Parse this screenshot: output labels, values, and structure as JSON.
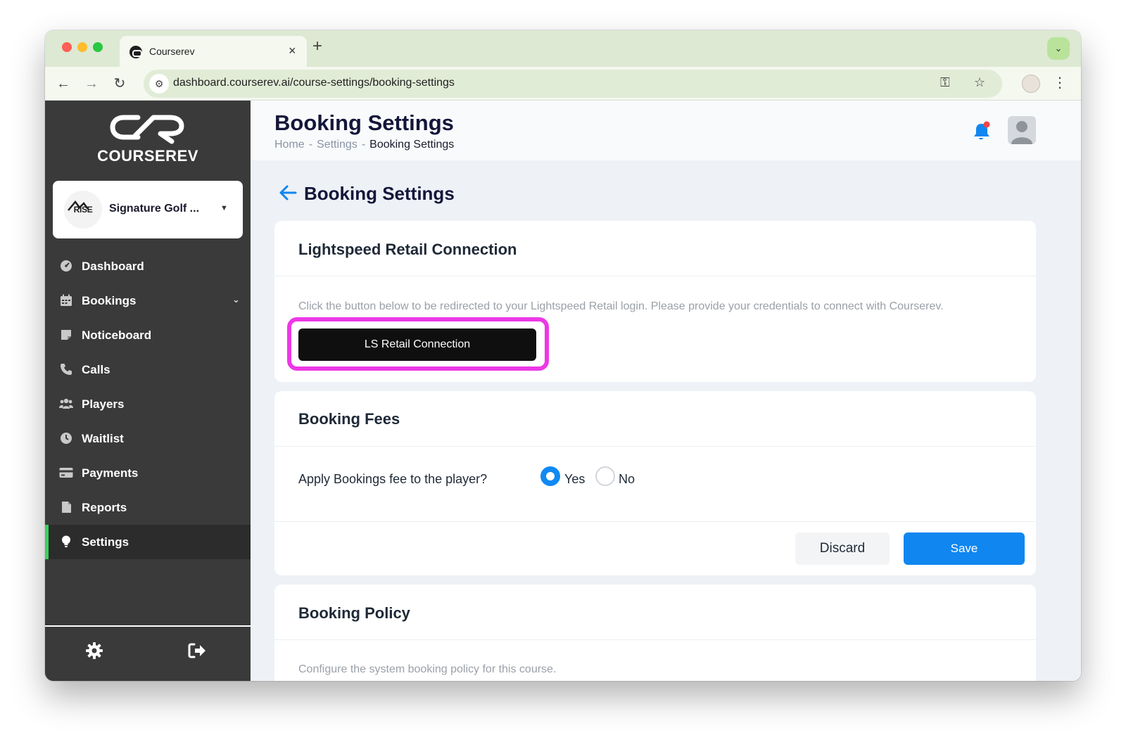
{
  "browser": {
    "tab_title": "Courserev",
    "tab_close": "×",
    "new_tab": "+",
    "url": "dashboard.courserev.ai/course-settings/booking-settings",
    "nav": {
      "back": "←",
      "forward": "→",
      "reload": "↻"
    }
  },
  "sidebar": {
    "brand": "COURSEREV",
    "org": {
      "logo_text": "RISE",
      "name": "Signature Golf ..."
    },
    "items": [
      {
        "label": "Dashboard",
        "icon": "dashboard-icon"
      },
      {
        "label": "Bookings",
        "icon": "calendar-icon",
        "has_submenu": true
      },
      {
        "label": "Noticeboard",
        "icon": "note-icon"
      },
      {
        "label": "Calls",
        "icon": "phone-icon"
      },
      {
        "label": "Players",
        "icon": "users-icon"
      },
      {
        "label": "Waitlist",
        "icon": "clock-icon"
      },
      {
        "label": "Payments",
        "icon": "credit-card-icon"
      },
      {
        "label": "Reports",
        "icon": "file-icon"
      },
      {
        "label": "Settings",
        "icon": "lightbulb-icon",
        "active": true
      }
    ],
    "footer": {
      "settings_icon": "gear-icon",
      "logout_icon": "logout-icon"
    }
  },
  "header": {
    "title": "Booking Settings",
    "breadcrumb": {
      "home": "Home",
      "sep": "-",
      "settings": "Settings",
      "current": "Booking Settings"
    }
  },
  "section": {
    "title": "Booking Settings"
  },
  "lightspeed": {
    "title": "Lightspeed Retail Connection",
    "description": "Click the button below to be redirected to your Lightspeed Retail login. Please provide your credentials to connect with Courserev.",
    "button": "LS Retail Connection"
  },
  "booking_fees": {
    "title": "Booking Fees",
    "question": "Apply Bookings fee to the player?",
    "options": [
      "Yes",
      "No"
    ],
    "selected": "Yes",
    "discard": "Discard",
    "save": "Save"
  },
  "booking_policy": {
    "title": "Booking Policy",
    "description": "Configure the system booking policy for this course."
  },
  "colors": {
    "accent": "#0f86f0",
    "sidebar_bg": "#3a3a3a",
    "active_indicator": "#3ad05e",
    "highlight": "#ec38e6",
    "notification_dot": "#ef4444"
  }
}
